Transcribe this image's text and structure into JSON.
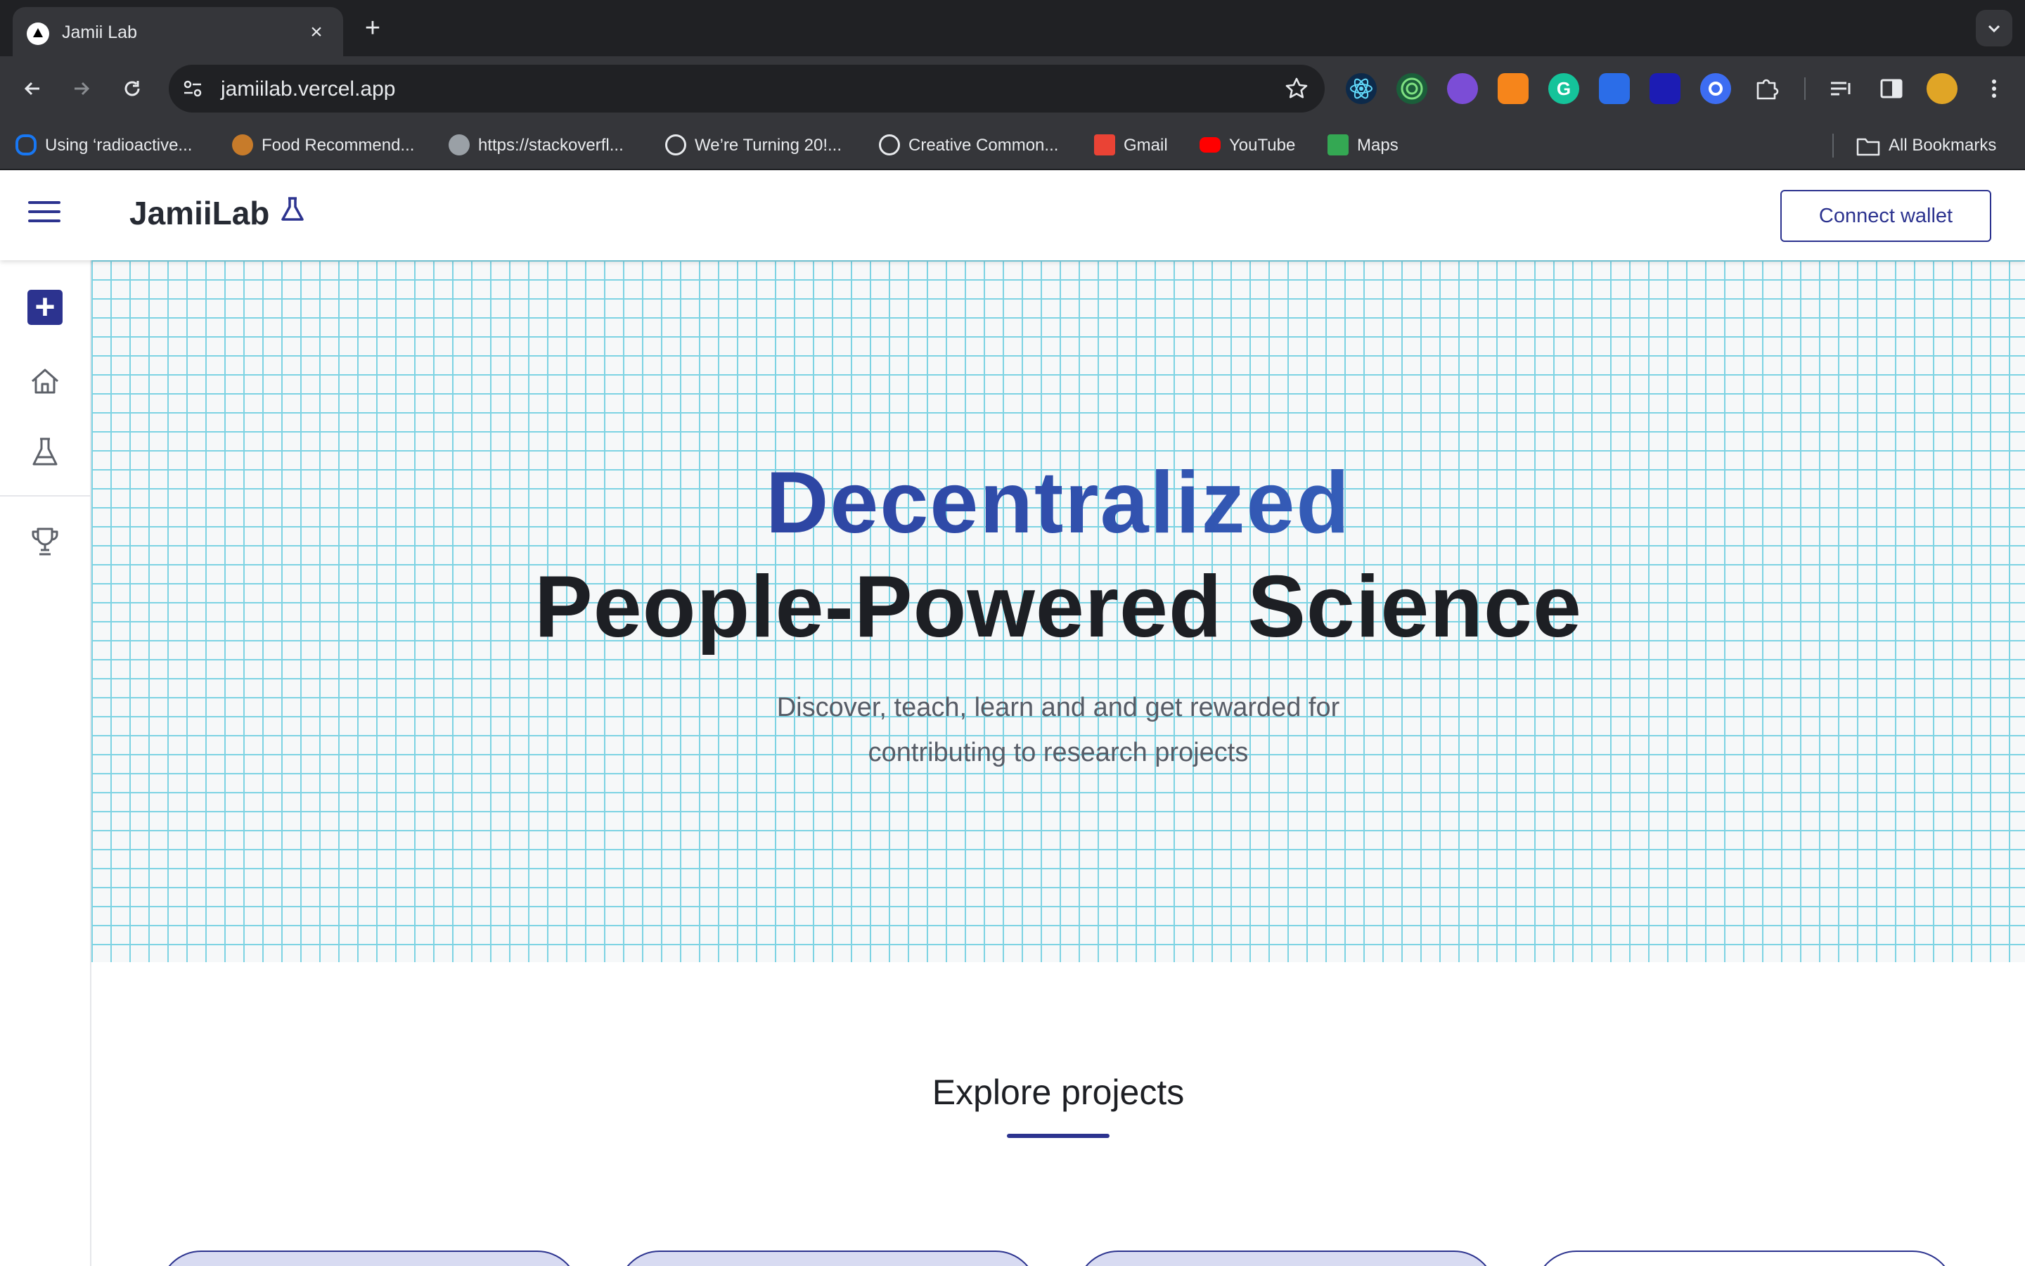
{
  "browser": {
    "tab_title": "Jamii Lab",
    "url": "jamiilab.vercel.app",
    "bookmarks": [
      {
        "label": "Using ‘radioactive...",
        "icon": "meta-icon",
        "color": "#1877f2"
      },
      {
        "label": "Food Recommend...",
        "icon": "food-site-icon",
        "color": "#c77b2a"
      },
      {
        "label": "https://stackoverfl...",
        "icon": "globe-icon",
        "color": "#9aa0a6"
      },
      {
        "label": "We’re Turning 20!...",
        "icon": "creative-commons-icon",
        "color": "#e8eaed"
      },
      {
        "label": "Creative Common...",
        "icon": "creative-commons-icon",
        "color": "#e8eaed"
      },
      {
        "label": "Gmail",
        "icon": "gmail-icon",
        "color": "#ea4335"
      },
      {
        "label": "YouTube",
        "icon": "youtube-icon",
        "color": "#ff0000"
      },
      {
        "label": "Maps",
        "icon": "maps-icon",
        "color": "#34a853"
      }
    ],
    "all_bookmarks": "All Bookmarks"
  },
  "header": {
    "logo": "JamiiLab",
    "connect_button": "Connect wallet"
  },
  "sidebar": {
    "items": [
      {
        "name": "add-project",
        "icon": "plus-icon"
      },
      {
        "name": "home",
        "icon": "home-icon"
      },
      {
        "name": "lab",
        "icon": "flask-icon"
      },
      {
        "name": "leaderboard",
        "icon": "trophy-icon"
      }
    ]
  },
  "hero": {
    "accent": "Decentralized",
    "headline": "People-Powered Science",
    "subtitle_line1": "Discover, teach, learn and and get rewarded for",
    "subtitle_line2": "contributing to research projects"
  },
  "explore": {
    "title": "Explore projects"
  },
  "colors": {
    "brand": "#2c338f",
    "accent_gradient_end": "#3e7fd4",
    "grid_line": "#7dd3e3"
  }
}
